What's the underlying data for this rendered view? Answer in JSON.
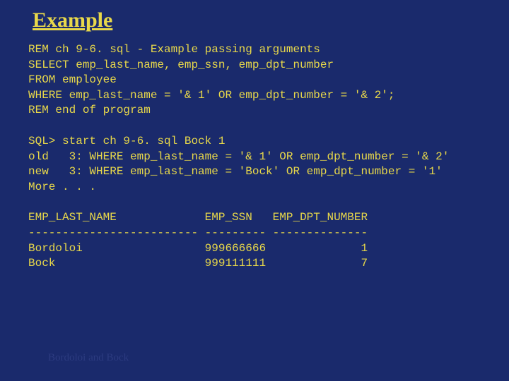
{
  "title": "Example",
  "block1": {
    "l1": "REM ch 9-6. sql - Example passing arguments",
    "l2": "SELECT emp_last_name, emp_ssn, emp_dpt_number",
    "l3": "FROM employee",
    "l4": "WHERE emp_last_name = '& 1' OR emp_dpt_number = '& 2';",
    "l5": "REM end of program"
  },
  "block2": {
    "l1": "SQL> start ch 9-6. sql Bock 1",
    "l2": "old   3: WHERE emp_last_name = '& 1' OR emp_dpt_number = '& 2'",
    "l3": "new   3: WHERE emp_last_name = 'Bock' OR emp_dpt_number = '1'",
    "l4": "More . . ."
  },
  "block3": {
    "l1": "EMP_LAST_NAME             EMP_SSN   EMP_DPT_NUMBER",
    "l2": "------------------------- --------- --------------",
    "l3": "Bordoloi                  999666666              1",
    "l4": "Bock                      999111111              7"
  },
  "footer": "Bordoloi and Bock",
  "chart_data": {
    "type": "table",
    "title": "Example",
    "columns": [
      "EMP_LAST_NAME",
      "EMP_SSN",
      "EMP_DPT_NUMBER"
    ],
    "rows": [
      {
        "EMP_LAST_NAME": "Bordoloi",
        "EMP_SSN": "999666666",
        "EMP_DPT_NUMBER": 1
      },
      {
        "EMP_LAST_NAME": "Bock",
        "EMP_SSN": "999111111",
        "EMP_DPT_NUMBER": 7
      }
    ]
  }
}
